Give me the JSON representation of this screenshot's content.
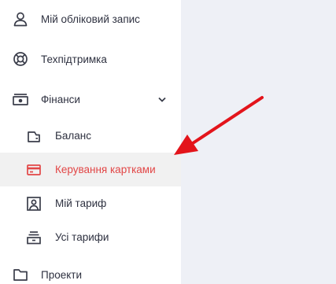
{
  "menu": {
    "account": {
      "label": "Мій обліковий запис",
      "icon": "user-icon"
    },
    "support": {
      "label": "Техпідтримка",
      "icon": "lifebuoy-icon"
    },
    "finance": {
      "label": "Фінанси",
      "icon": "cash-icon",
      "expanded": true
    },
    "balance": {
      "label": "Баланс",
      "icon": "wallet-icon"
    },
    "cards": {
      "label": "Керування картками",
      "icon": "credit-card-icon",
      "active": true
    },
    "my_tariff": {
      "label": "Мій тариф",
      "icon": "tariff-portrait-icon"
    },
    "all_tariffs": {
      "label": "Усі тарифи",
      "icon": "stack-icon"
    },
    "projects": {
      "label": "Проекти",
      "icon": "folder-icon"
    }
  },
  "colors": {
    "active_text": "#e24646",
    "active_bg": "#f1f1f1",
    "text": "#2e3140",
    "icon": "#3a3d4a",
    "content_bg": "#eef0f6",
    "annotation_arrow": "#e3141b"
  }
}
